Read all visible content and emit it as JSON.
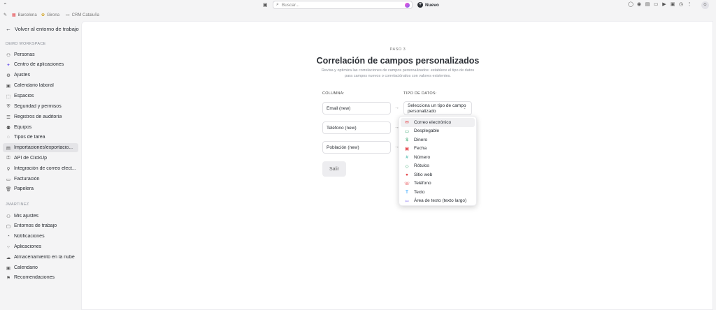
{
  "topbar": {
    "search_placeholder": "Buscar...",
    "new_label": "Nuevo"
  },
  "favorites": [
    {
      "label": "Barcelona",
      "icon": "grid-icon",
      "color": "#e5484d"
    },
    {
      "label": "Girona",
      "icon": "spaces-icon",
      "color": "#d4a72c"
    },
    {
      "label": "CRM Cataluña",
      "icon": "list-icon",
      "color": "#777777"
    }
  ],
  "sidebar": {
    "back_label": "Volver al entorno de trabajo",
    "workspace_section": "DEMO WORKSPACE",
    "workspace_items": [
      {
        "label": "Personas",
        "icon": "people-icon"
      },
      {
        "label": "Centro de aplicaciones",
        "icon": "apps-center-icon"
      },
      {
        "label": "Ajustes",
        "icon": "settings-icon"
      },
      {
        "label": "Calendario laboral",
        "icon": "calendar-icon"
      },
      {
        "label": "Espacios",
        "icon": "spaces-icon"
      },
      {
        "label": "Seguridad y permisos",
        "icon": "shield-icon"
      },
      {
        "label": "Registros de auditoría",
        "icon": "audit-log-icon"
      },
      {
        "label": "Equipos",
        "icon": "teams-icon"
      },
      {
        "label": "Tipos de tarea",
        "icon": "task-type-icon"
      },
      {
        "label": "Importaciones/exportacio...",
        "icon": "import-export-icon",
        "active": true
      },
      {
        "label": "API de ClickUp",
        "icon": "api-icon"
      },
      {
        "label": "Integración de correo elect...",
        "icon": "email-integration-icon"
      },
      {
        "label": "Facturación",
        "icon": "billing-icon"
      },
      {
        "label": "Papelera",
        "icon": "trash-icon"
      }
    ],
    "user_section": "JMARTINEZ",
    "user_items": [
      {
        "label": "Mis ajustes",
        "icon": "user-settings-icon"
      },
      {
        "label": "Entornos de trabajo",
        "icon": "workspaces-icon"
      },
      {
        "label": "Notificaciones",
        "icon": "bell-icon"
      },
      {
        "label": "Aplicaciones",
        "icon": "apps-icon"
      },
      {
        "label": "Almacenamiento en la nube",
        "icon": "cloud-icon"
      },
      {
        "label": "Calendario",
        "icon": "calendar-icon"
      },
      {
        "label": "Recomendaciones",
        "icon": "gift-icon"
      }
    ]
  },
  "main": {
    "step": "PASO 3",
    "title": "Correlación de campos personalizados",
    "description": "Revisa y optimiza las correlaciones de campos personalizados: establece el tipo de datos para campos nuevos o correlaciónalos con valores existentes.",
    "column_header": "COLUMNA:",
    "type_header": "TIPO DE DATOS:",
    "fields": [
      "Email (new)",
      "Teléfono (new)",
      "Población (new)"
    ],
    "type_select_placeholder": "Selecciona un tipo de campo personalizado",
    "exit_label": "Salir"
  },
  "dropdown_options": [
    {
      "label": "Correo electrónico",
      "icon": "email-icon",
      "color": "#e5484d",
      "highlighted": true
    },
    {
      "label": "Desplegable",
      "icon": "dropdown-icon",
      "color": "#30a46c"
    },
    {
      "label": "Dinero",
      "icon": "money-icon",
      "color": "#30a46c"
    },
    {
      "label": "Fecha",
      "icon": "date-icon",
      "color": "#e5484d"
    },
    {
      "label": "Número",
      "icon": "number-icon",
      "color": "#12a594"
    },
    {
      "label": "Rótulos",
      "icon": "label-icon",
      "color": "#30a46c"
    },
    {
      "label": "Sitio web",
      "icon": "website-icon",
      "color": "#e5484d"
    },
    {
      "label": "Teléfono",
      "icon": "phone-icon",
      "color": "#e5484d"
    },
    {
      "label": "Texto",
      "icon": "text-icon",
      "color": "#0090ff"
    },
    {
      "label": "Área de texto (texto largo)",
      "icon": "textarea-icon",
      "color": "#7b68ee"
    }
  ]
}
